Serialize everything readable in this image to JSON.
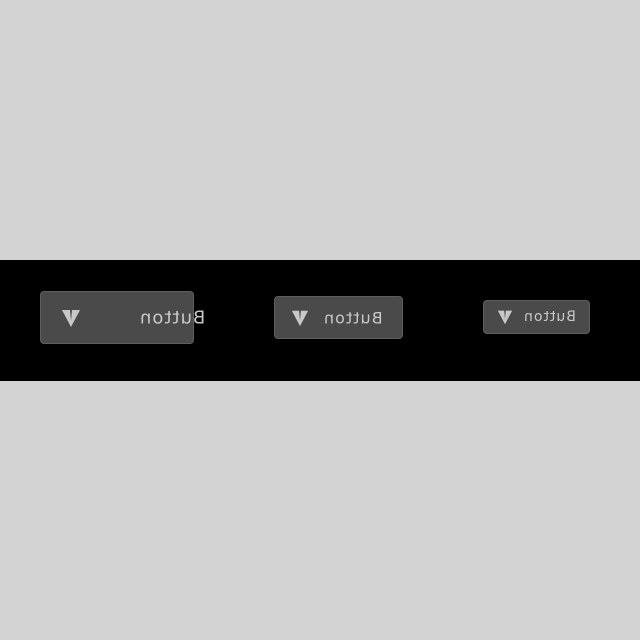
{
  "buttons": [
    {
      "label": "Button",
      "icon": "v-logo-icon",
      "size": "large"
    },
    {
      "label": "Button",
      "icon": "v-logo-icon",
      "size": "medium"
    },
    {
      "label": "Button",
      "icon": "v-logo-icon",
      "size": "small"
    }
  ],
  "colors": {
    "background": "#d3d3d3",
    "band": "#000000",
    "button_fill": "#4a4a4a",
    "button_text": "#c8c8c8"
  }
}
